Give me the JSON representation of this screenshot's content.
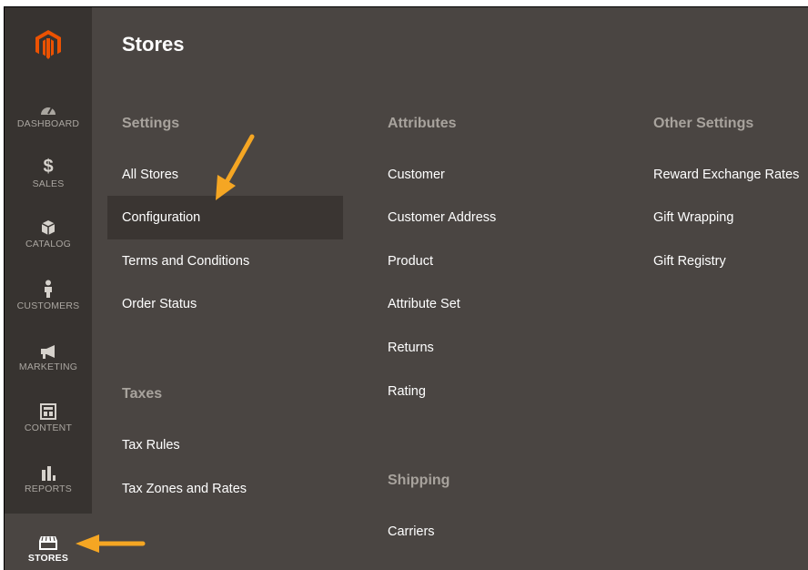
{
  "page_title": "Stores",
  "sidebar": {
    "logo": "magento-logo",
    "items": [
      {
        "label": "DASHBOARD",
        "icon": "dashboard-icon"
      },
      {
        "label": "SALES",
        "icon": "dollar-icon"
      },
      {
        "label": "CATALOG",
        "icon": "box-icon"
      },
      {
        "label": "CUSTOMERS",
        "icon": "person-icon"
      },
      {
        "label": "MARKETING",
        "icon": "megaphone-icon"
      },
      {
        "label": "CONTENT",
        "icon": "layout-icon"
      },
      {
        "label": "REPORTS",
        "icon": "bar-chart-icon"
      },
      {
        "label": "STORES",
        "icon": "storefront-icon",
        "active": true
      }
    ]
  },
  "columns": {
    "settings": {
      "heading": "Settings",
      "links": [
        "All Stores",
        "Configuration",
        "Terms and Conditions",
        "Order Status"
      ]
    },
    "taxes": {
      "heading": "Taxes",
      "links": [
        "Tax Rules",
        "Tax Zones and Rates"
      ]
    },
    "attributes": {
      "heading": "Attributes",
      "links": [
        "Customer",
        "Customer Address",
        "Product",
        "Attribute Set",
        "Returns",
        "Rating"
      ]
    },
    "shipping": {
      "heading": "Shipping",
      "links": [
        "Carriers"
      ]
    },
    "other_settings": {
      "heading": "Other Settings",
      "links": [
        "Reward Exchange Rates",
        "Gift Wrapping",
        "Gift Registry"
      ]
    }
  },
  "colors": {
    "accent": "#eb5202",
    "annotation_arrow": "#f5a623",
    "panel_bg": "#4a4542",
    "sidebar_bg": "#373330"
  }
}
